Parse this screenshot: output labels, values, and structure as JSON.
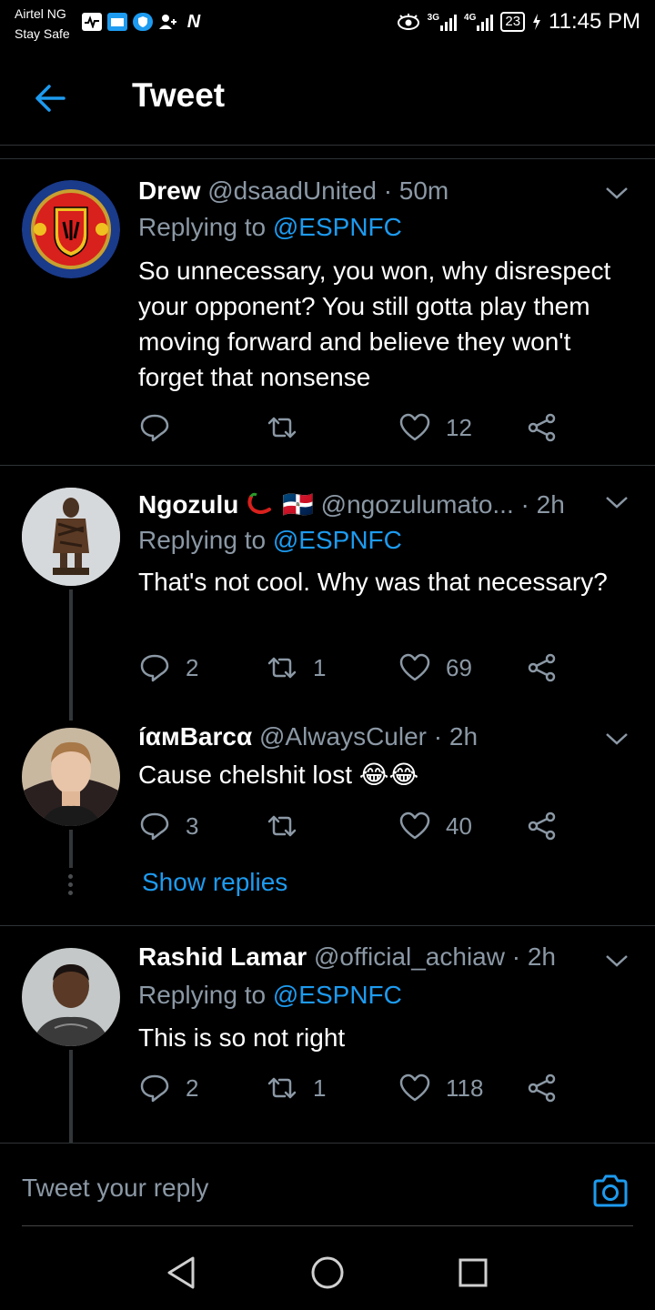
{
  "status_bar": {
    "carrier_line1": "Airtel NG",
    "carrier_line2": "Stay Safe",
    "net1": "3G",
    "net2": "4G",
    "battery": "23",
    "time": "11:45 PM"
  },
  "header": {
    "title": "Tweet"
  },
  "tweets": [
    {
      "name": "Drew",
      "handle": "@dsaadUnited",
      "time": "· 50m",
      "reply_prefix": "Replying to",
      "reply_handle": "@ESPNFC",
      "text": "So unnecessary, you won, why disrespect your opponent? You still gotta play them moving forward and believe they won't forget that nonsense",
      "replies": "",
      "retweets": "",
      "likes": "12"
    },
    {
      "name": "Ngozulu",
      "flag": "🇩🇴",
      "handle": "@ngozulumato...",
      "time": "· 2h",
      "reply_prefix": "Replying to",
      "reply_handle": "@ESPNFC",
      "text": "That's not cool. Why was that necessary?",
      "replies": "2",
      "retweets": "1",
      "likes": "69"
    },
    {
      "name": "íαмBarcα",
      "handle": "@AlwaysCuler",
      "time": "· 2h",
      "text": "Cause chelshit lost 😂😂",
      "replies": "3",
      "retweets": "",
      "likes": "40",
      "show_replies": "Show replies"
    },
    {
      "name": "Rashid Lamar",
      "handle": "@official_achiaw",
      "time": "· 2h",
      "reply_prefix": "Replying to",
      "reply_handle": "@ESPNFC",
      "text": "This is so not right",
      "replies": "2",
      "retweets": "1",
      "likes": "118"
    }
  ],
  "compose": {
    "placeholder": "Tweet your reply"
  },
  "colors": {
    "accent": "#1d9bf0",
    "muted": "#8b98a5",
    "background": "#000000"
  }
}
